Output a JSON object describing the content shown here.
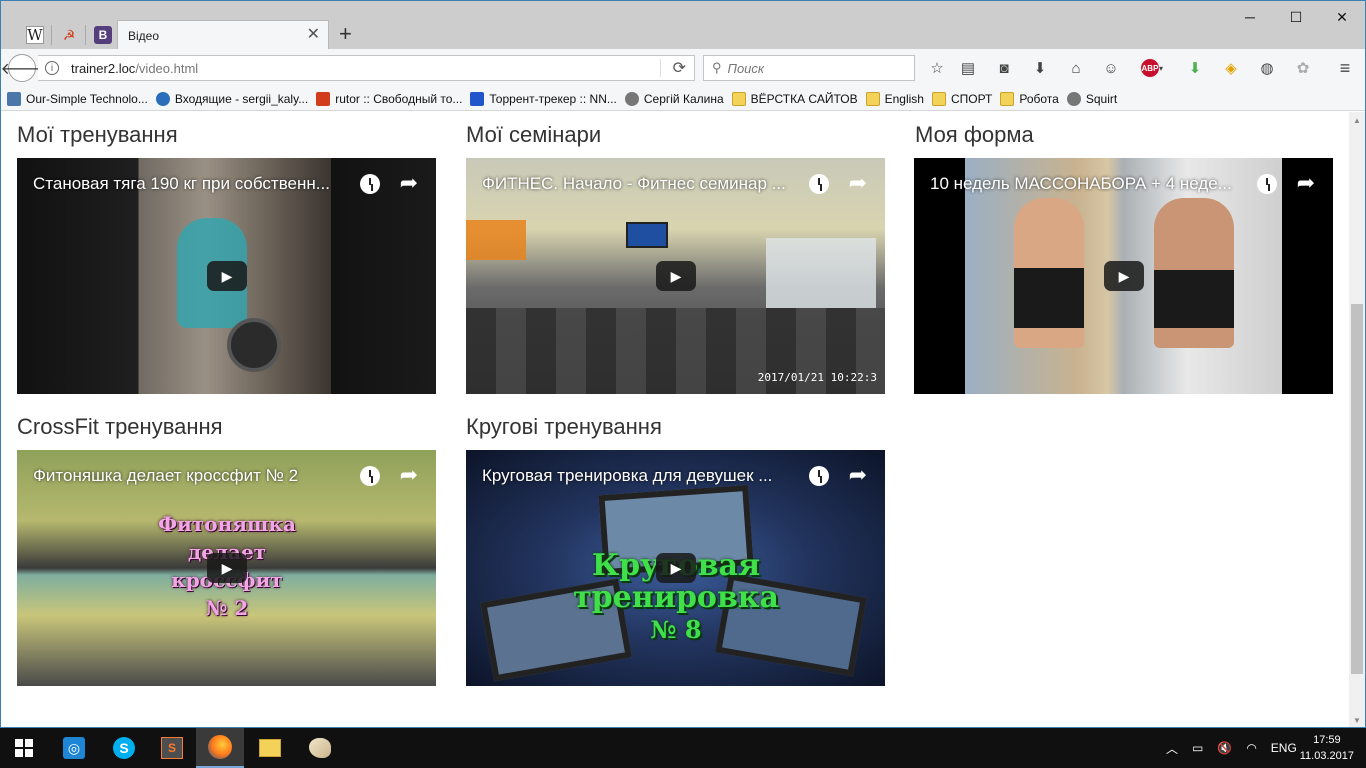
{
  "browser": {
    "tabs": [
      {
        "icon": "wikipedia-icon",
        "glyph": "W"
      },
      {
        "icon": "rutor-icon",
        "glyph": "☭"
      },
      {
        "icon": "bootstrap-icon",
        "glyph": "B"
      }
    ],
    "active_tab": {
      "title": "Відео"
    },
    "url": {
      "host": "trainer2.loc",
      "path": "/video.html"
    },
    "search_placeholder": "Поиск",
    "window_controls": {
      "minimize": "─",
      "maximize": "☐",
      "close": "✕"
    }
  },
  "bookmarks": [
    {
      "label": "Our-Simple Technolo...",
      "icon": "vk-icon",
      "color": "#4a76a8"
    },
    {
      "label": "Входящие - sergii_kaly...",
      "icon": "mail-icon",
      "color": "#2a6ebb"
    },
    {
      "label": "rutor :: Свободный то...",
      "icon": "rutor-icon",
      "color": "#d13c1c"
    },
    {
      "label": "Торрент-трекер :: NN...",
      "icon": "butterfly-icon",
      "color": "#2255cc"
    },
    {
      "label": "Сергій Калина",
      "icon": "globe-icon",
      "color": "#777777"
    },
    {
      "label": "ВЁРСТКА САЙТОВ",
      "icon": "folder-icon",
      "color": "#f3d25a"
    },
    {
      "label": "English",
      "icon": "folder-icon",
      "color": "#f3d25a"
    },
    {
      "label": "СПОРТ",
      "icon": "folder-icon",
      "color": "#f3d25a"
    },
    {
      "label": "Робота",
      "icon": "folder-icon",
      "color": "#f3d25a"
    },
    {
      "label": "Squirt",
      "icon": "globe-icon",
      "color": "#777777"
    }
  ],
  "sections": [
    {
      "title": "Мої тренування",
      "video_title": "Становая тяга 190 кг при собственн..."
    },
    {
      "title": "Мої семінари",
      "video_title": "ФИТНЕС. Начало - Фитнес семинар ...",
      "timestamp": "2017/01/21  10:22:3"
    },
    {
      "title": "Моя форма",
      "video_title": "10 недель МАССОНАБОРА + 4 неде..."
    },
    {
      "title": "CrossFit тренування",
      "video_title": "Фитоняшка делает кроссфит № 2",
      "overlay": [
        "Фитоняшка",
        "делает",
        "кроссфит",
        "№ 2"
      ]
    },
    {
      "title": "Кругові тренування",
      "video_title": "Круговая тренировка для девушек ...",
      "overlay": [
        "Круговая тренировка",
        "№ 8"
      ]
    }
  ],
  "taskbar": {
    "apps": [
      "windows-start-icon",
      "instagram-icon",
      "skype-icon",
      "sublime-icon",
      "firefox-icon",
      "explorer-icon",
      "paint-icon"
    ],
    "language": "ENG",
    "time": "17:59",
    "date": "11.03.2017"
  }
}
